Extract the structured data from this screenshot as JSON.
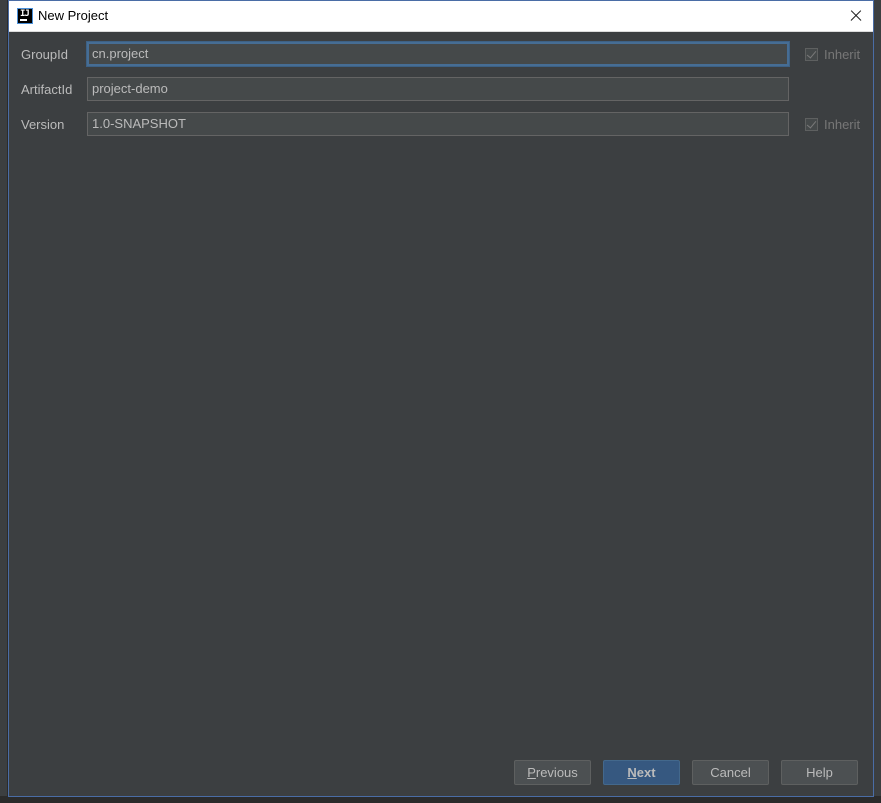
{
  "window": {
    "title": "New Project",
    "icon": "intellij-idea-icon",
    "icon_text": "IJ"
  },
  "form": {
    "group_id": {
      "label": "GroupId",
      "value": "cn.project",
      "inherit_label": "Inherit",
      "inherit_checked": true
    },
    "artifact_id": {
      "label": "ArtifactId",
      "value": "project-demo"
    },
    "version": {
      "label": "Version",
      "value": "1.0-SNAPSHOT",
      "inherit_label": "Inherit",
      "inherit_checked": true
    }
  },
  "buttons": {
    "previous": {
      "mnemonic": "P",
      "rest": "revious"
    },
    "next": {
      "mnemonic": "N",
      "rest": "ext"
    },
    "cancel": "Cancel",
    "help": "Help"
  },
  "colors": {
    "dialog_bg": "#3c3f41",
    "field_bg": "#45494a",
    "focus_border": "#466d94",
    "primary_button": "#365880",
    "text": "#bbbbbb"
  }
}
